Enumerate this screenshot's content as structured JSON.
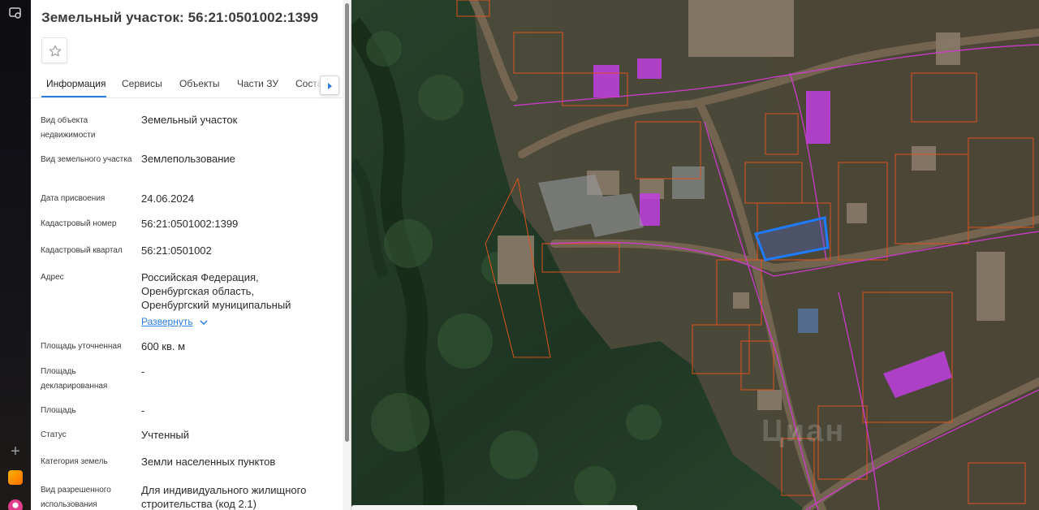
{
  "panel": {
    "title": "Земельный участок: 56:21:0501002:1399",
    "tabs": [
      "Информация",
      "Сервисы",
      "Объекты",
      "Части ЗУ",
      "Соста"
    ],
    "rows": [
      {
        "label": "Вид объекта недвижимости",
        "value": "Земельный участок"
      },
      {
        "label": "Вид земельного участка",
        "value": "Землепользование"
      },
      {
        "label": "Дата присвоения",
        "value": "24.06.2024"
      },
      {
        "label": "Кадастровый номер",
        "value": "56:21:0501002:1399"
      },
      {
        "label": "Кадастровый квартал",
        "value": "56:21:0501002"
      },
      {
        "label": "Адрес",
        "value": "Российская Федерация, Оренбургская область, Оренбургский муниципальный"
      },
      {
        "label": "Площадь уточненная",
        "value": "600 кв. м"
      },
      {
        "label": "Площадь декларированная",
        "value": "-"
      },
      {
        "label": "Площадь",
        "value": "-"
      },
      {
        "label": "Статус",
        "value": "Учтенный"
      },
      {
        "label": "Категория земель",
        "value": "Земли населенных пунктов"
      },
      {
        "label": "Вид разрешенного использования",
        "value": "Для индивидуального жилищного строительства (код 2.1)"
      }
    ],
    "expand_link": "Развернуть"
  },
  "map": {
    "watermark": "Циан",
    "colors": {
      "selected_outline": "#1e7bff",
      "parcel_outline": "#e0531f",
      "quarter_outline": "#d23ad2",
      "building_fill": "#c03fe0"
    }
  },
  "icons": {
    "rail_top": "screen-capture-icon",
    "favorite": "star-icon",
    "tabs_scroll": "chevron-right-icon",
    "expand": "chevron-down-icon"
  }
}
